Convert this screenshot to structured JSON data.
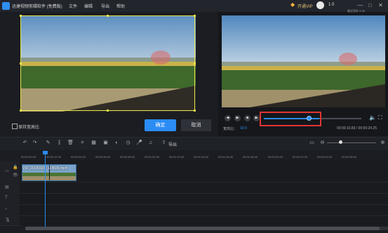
{
  "app": {
    "logo_text": "",
    "title": "迅捷视频剪辑软件 (免费版)",
    "menu": [
      "文件",
      "编辑",
      "导出",
      "帮助"
    ],
    "vip_label": "开通VIP",
    "user_initial": "",
    "user_name": "1 0",
    "window_buttons": [
      "—",
      "□",
      "✕"
    ]
  },
  "crop_panel": {
    "keep_ratio_label": "保持宽高比",
    "keep_ratio_checked": false,
    "confirm_label": "确定",
    "cancel_label": "取消"
  },
  "preview": {
    "preview_label": "最近保存 9:36",
    "aspect_label": "宽高比：",
    "aspect_value": "16:9",
    "timecode": "00:00:10.83 / 00:00:24.25",
    "progress": 0.45,
    "controls": [
      "step-back-icon",
      "play-icon",
      "stop-icon",
      "step-forward-icon"
    ]
  },
  "toolbar": {
    "export_label": "导出",
    "tools": [
      "undo-icon",
      "redo-icon",
      "edit-icon",
      "delete-icon",
      "split-icon",
      "crop-icon",
      "mosaic-icon",
      "freeze-icon",
      "color-icon",
      "speed-icon",
      "mic-icon",
      "music-icon",
      "export-icon"
    ]
  },
  "timeline": {
    "ticks": [
      "00:00:00.00",
      "00:00:12.00",
      "00:00:24.00",
      "00:00:36.00",
      "00:00:48.00",
      "00:01:00.00",
      "00:01:12.00",
      "00:01:24.00",
      "00:01:36.00",
      "00:01:48.00",
      "00:02:00.00",
      "00:02:12.00",
      "00:02:24.00",
      "00:02:36.00"
    ],
    "clip_name": "VID_20190926_114836.mp4",
    "track_icons": [
      "video-track-icon",
      "pip-track-icon",
      "text-track-icon",
      "music-track-icon",
      "voice-track-icon"
    ]
  },
  "colors": {
    "accent": "#2b8cf3",
    "crop_frame": "#e6e34a",
    "highlight": "#e13535"
  }
}
